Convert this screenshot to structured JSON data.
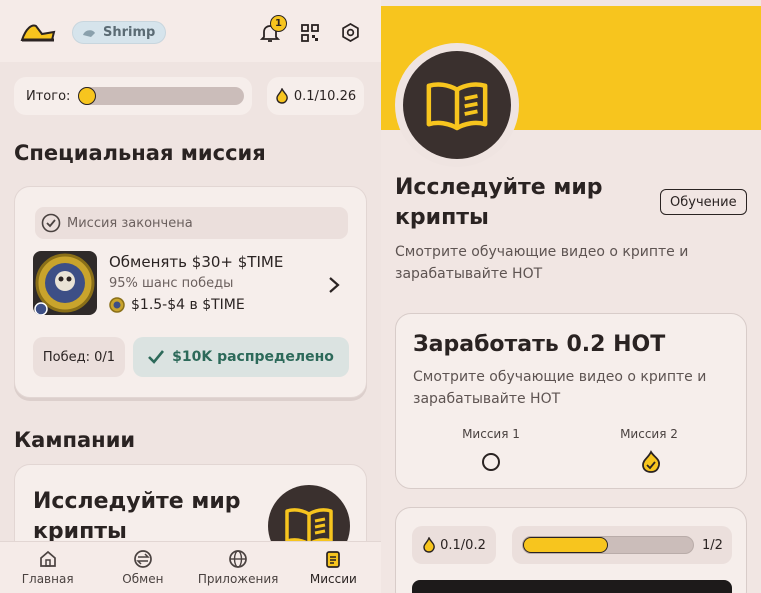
{
  "header": {
    "rank_label": "Shrimp",
    "notification_count": "1"
  },
  "summary": {
    "total_label": "Итого:",
    "total_progress": 0.0,
    "hot_value": "0.1/10.26"
  },
  "special": {
    "heading": "Специальная миссия",
    "status": "Миссия закончена",
    "title": "Обменять $30+ $TIME",
    "chance": "95% шанс победы",
    "reward": "$1.5-$4 в $TIME",
    "wins": "Побед: 0/1",
    "distributed": "$10K распределено"
  },
  "campaigns": {
    "heading": "Кампании",
    "card_title": "Исследуйте мир крипты"
  },
  "nav": {
    "items": [
      {
        "label": "Главная",
        "icon": "home-icon"
      },
      {
        "label": "Обмен",
        "icon": "exchange-icon"
      },
      {
        "label": "Приложения",
        "icon": "globe-icon"
      },
      {
        "label": "Миссии",
        "icon": "missions-icon"
      }
    ]
  },
  "detail": {
    "title": "Исследуйте мир крипты",
    "tag": "Обучение",
    "description": "Смотрите обучающие видео о крипте и зарабатывайте HOT",
    "earn_title": "Заработать 0.2 HOT",
    "earn_description": "Смотрите обучающие видео о крипте и зарабатывайте HOT",
    "mission1": "Миссия 1",
    "mission2": "Миссия 2",
    "hot_progress": "0.1/0.2",
    "step_progress": "1/2",
    "step_fraction": 0.5
  },
  "colors": {
    "accent": "#f7c51e",
    "background": "#f1e6e3",
    "dark": "#3a302e",
    "success": "#2d6a5a"
  }
}
